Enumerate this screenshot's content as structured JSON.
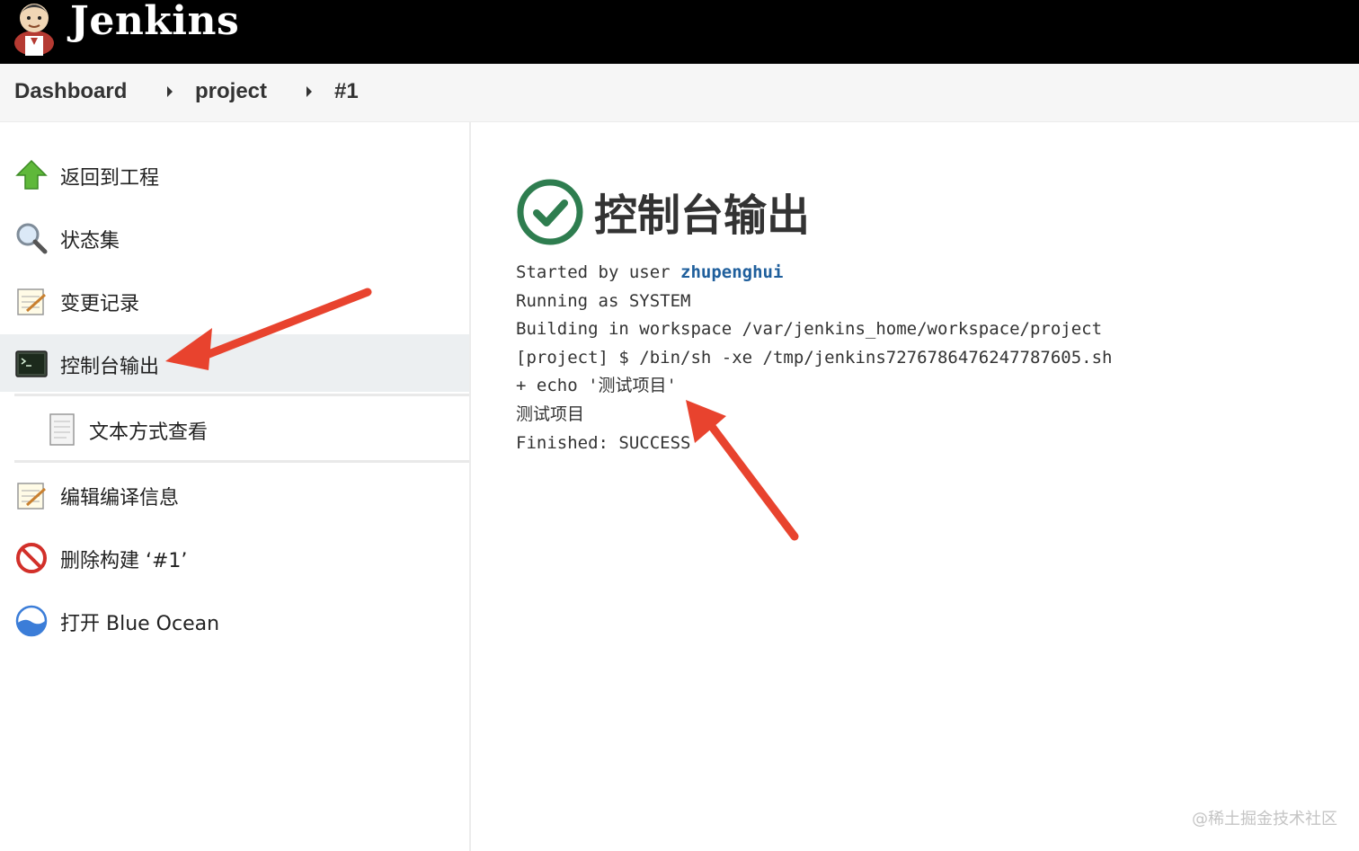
{
  "header": {
    "brand": "Jenkins",
    "logo_icon": "jenkins-butler-logo"
  },
  "breadcrumb": [
    {
      "label": "Dashboard"
    },
    {
      "label": "project"
    },
    {
      "label": "#1"
    }
  ],
  "sidebar": {
    "items": [
      {
        "label": "返回到工程",
        "icon": "up-arrow-icon",
        "active": false
      },
      {
        "label": "状态集",
        "icon": "magnifier-icon",
        "active": false
      },
      {
        "label": "变更记录",
        "icon": "notepad-icon",
        "active": false
      },
      {
        "label": "控制台输出",
        "icon": "terminal-icon",
        "active": true
      },
      {
        "label": "文本方式查看",
        "icon": "document-icon",
        "active": false,
        "sub": true
      },
      {
        "label": "编辑编译信息",
        "icon": "notepad-edit-icon",
        "active": false
      },
      {
        "label": "删除构建 ‘#1’",
        "icon": "no-entry-icon",
        "active": false
      },
      {
        "label": "打开 Blue Ocean",
        "icon": "blue-ocean-icon",
        "active": false
      }
    ]
  },
  "main": {
    "title": "控制台输出",
    "status_icon": "success-check-icon",
    "console": {
      "started_prefix": "Started by user ",
      "user": "zhupenghui",
      "lines": [
        "Running as SYSTEM",
        "Building in workspace /var/jenkins_home/workspace/project",
        "[project] $ /bin/sh -xe /tmp/jenkins7276786476247787605.sh",
        "+ echo '测试项目'",
        "测试项目",
        "Finished: SUCCESS"
      ]
    }
  },
  "watermark": "@稀土掘金技术社区",
  "colors": {
    "header_bg": "#000000",
    "success_green": "#2e7d4f",
    "link_blue": "#1f5f9c",
    "annotation_red": "#e8432e",
    "active_item_bg": "#eceff1"
  }
}
